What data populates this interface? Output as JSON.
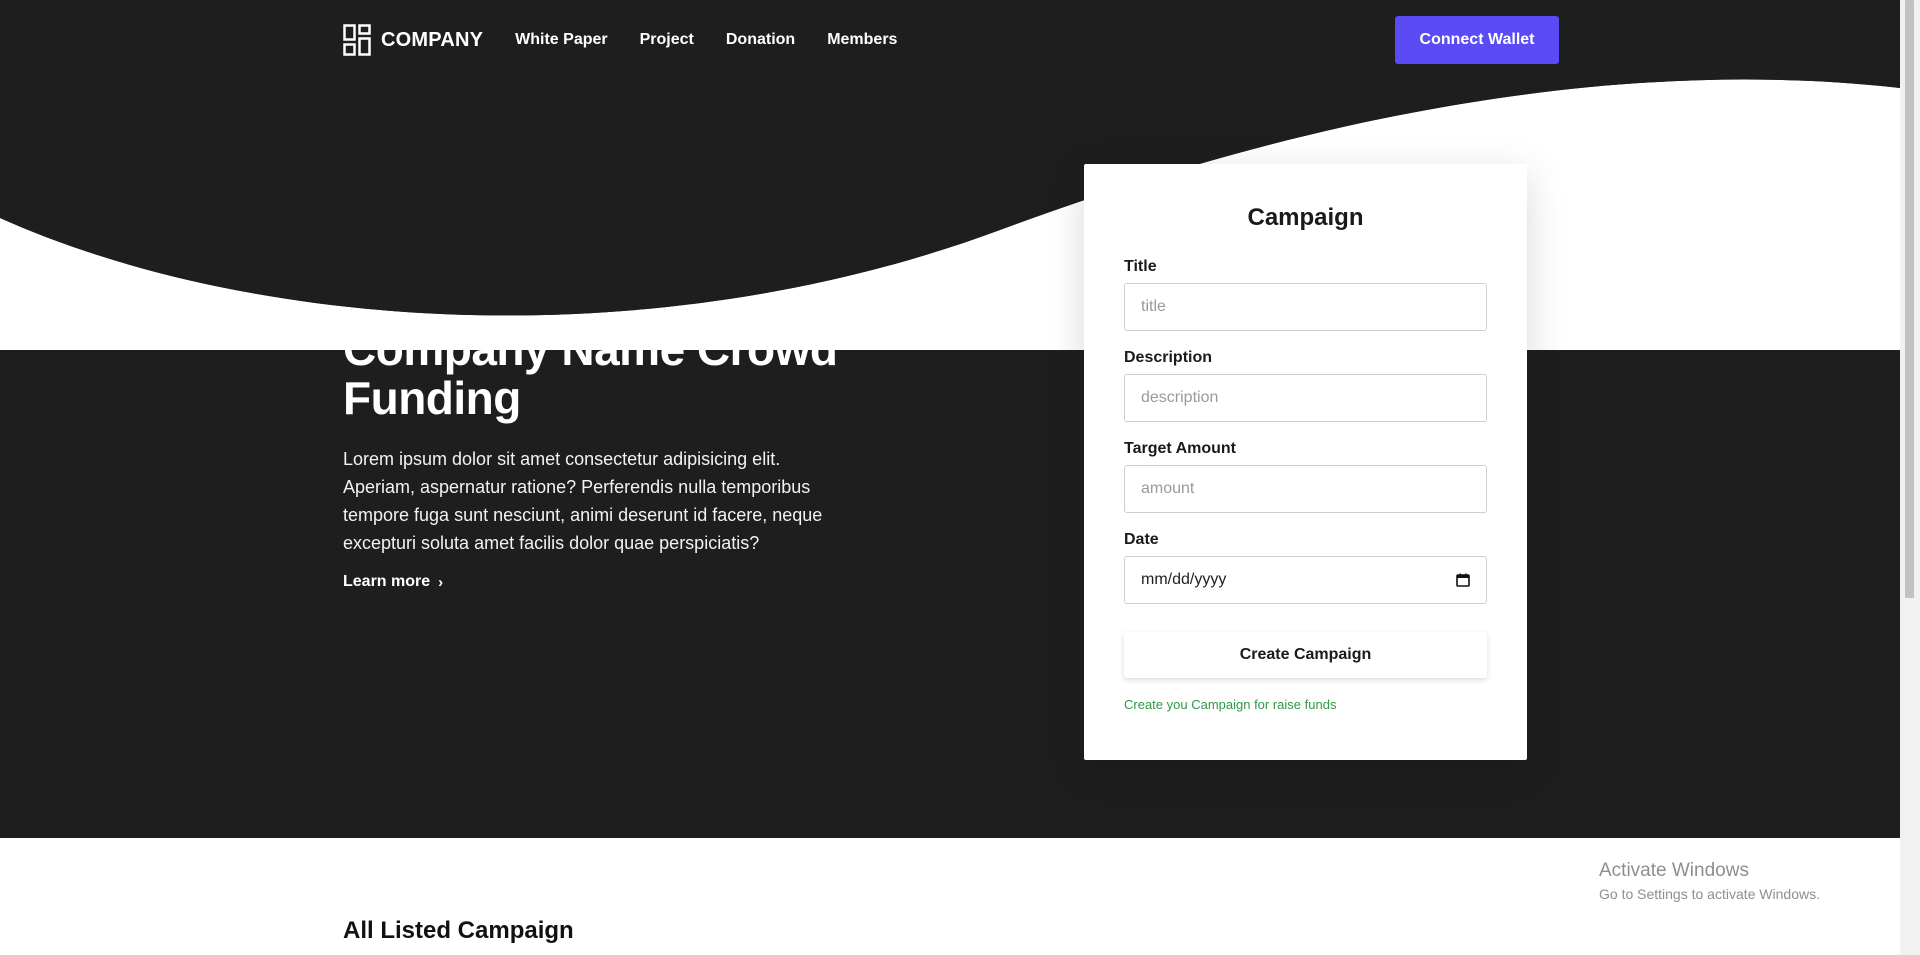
{
  "brand": {
    "name": "COMPANY",
    "icon": "grid-logo-icon"
  },
  "nav": {
    "links": [
      "White Paper",
      "Project",
      "Donation",
      "Members"
    ],
    "connect_label": "Connect Wallet"
  },
  "hero": {
    "title": "Company Name Crowd Funding",
    "description": "Lorem ipsum dolor sit amet consectetur adipisicing elit. Aperiam, aspernatur ratione? Perferendis nulla temporibus tempore fuga sunt nesciunt, animi deserunt id facere, neque excepturi soluta amet facilis dolor quae perspiciatis?",
    "learn_more": "Learn more"
  },
  "form": {
    "heading": "Campaign",
    "title_label": "Title",
    "title_placeholder": "title",
    "description_label": "Description",
    "description_placeholder": "description",
    "amount_label": "Target Amount",
    "amount_placeholder": "amount",
    "date_label": "Date",
    "date_value": "mm/dd/yyyy",
    "submit_label": "Create Campaign",
    "helper_text": "Create you Campaign for raise funds"
  },
  "section": {
    "title": "All Listed Campaign"
  },
  "watermark": {
    "title": "Activate Windows",
    "subtitle": "Go to Settings to activate Windows."
  },
  "colors": {
    "hero_bg": "#1e1e1f",
    "accent": "#5b4bf5",
    "helper": "#2f9a44"
  }
}
